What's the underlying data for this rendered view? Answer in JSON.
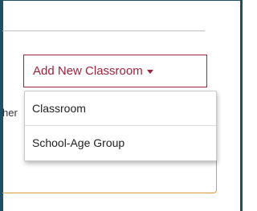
{
  "toolbar": {
    "add_button_label": "Add New Classroom"
  },
  "background": {
    "partial_text": "her"
  },
  "dropdown": {
    "items": [
      {
        "label": "Classroom"
      },
      {
        "label": "School-Age Group"
      }
    ]
  },
  "colors": {
    "accent": "#a3213b",
    "frame": "#1f4f64",
    "highlight_border": "#e09a3c"
  }
}
